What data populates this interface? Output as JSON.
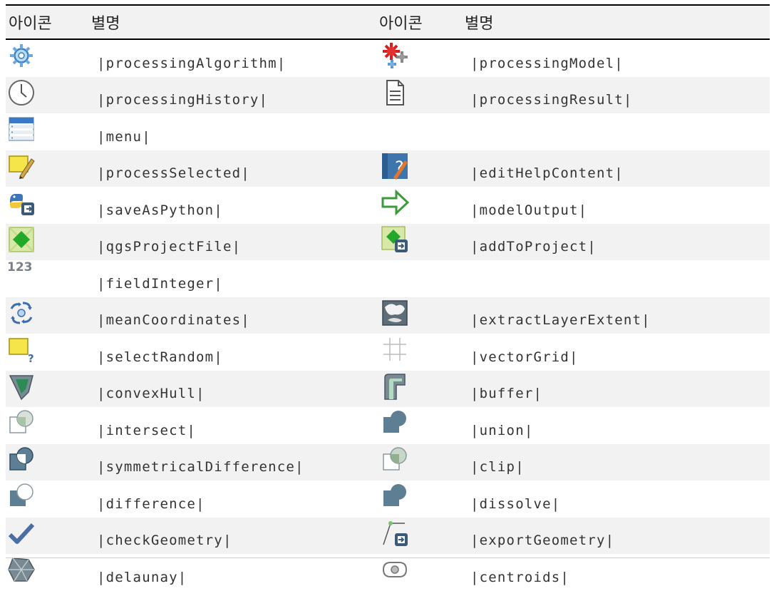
{
  "header": {
    "col1": "아이콘",
    "col2": "별명",
    "col3": "아이콘",
    "col4": "별명"
  },
  "rows": [
    {
      "icon1": "processing-algorithm-icon",
      "alias1": "|processingAlgorithm|",
      "icon2": "processing-model-icon",
      "alias2": "|processingModel|"
    },
    {
      "icon1": "processing-history-icon",
      "alias1": "|processingHistory|",
      "icon2": "processing-result-icon",
      "alias2": "|processingResult|"
    },
    {
      "icon1": "menu-icon",
      "alias1": "|menu|",
      "icon2": "",
      "alias2": ""
    },
    {
      "icon1": "process-selected-icon",
      "alias1": "|processSelected|",
      "icon2": "edit-help-content-icon",
      "alias2": "|editHelpContent|"
    },
    {
      "icon1": "save-as-python-icon",
      "alias1": "|saveAsPython|",
      "icon2": "model-output-icon",
      "alias2": "|modelOutput|"
    },
    {
      "icon1": "qgs-project-file-icon",
      "alias1": "|qgsProjectFile|",
      "icon2": "add-to-project-icon",
      "alias2": "|addToProject|"
    },
    {
      "icon1": "field-integer-icon",
      "icon1_text": "123",
      "alias1": "|fieldInteger|",
      "icon2": "",
      "alias2": ""
    },
    {
      "icon1": "mean-coordinates-icon",
      "alias1": "|meanCoordinates|",
      "icon2": "extract-layer-extent-icon",
      "alias2": "|extractLayerExtent|"
    },
    {
      "icon1": "select-random-icon",
      "alias1": "|selectRandom|",
      "icon2": "vector-grid-icon",
      "alias2": "|vectorGrid|"
    },
    {
      "icon1": "convex-hull-icon",
      "alias1": "|convexHull|",
      "icon2": "buffer-icon",
      "alias2": "|buffer|"
    },
    {
      "icon1": "intersect-icon",
      "alias1": "|intersect|",
      "icon2": "union-icon",
      "alias2": "|union|"
    },
    {
      "icon1": "symmetrical-difference-icon",
      "alias1": "|symmetricalDifference|",
      "icon2": "clip-icon",
      "alias2": "|clip|"
    },
    {
      "icon1": "difference-icon",
      "alias1": "|difference|",
      "icon2": "dissolve-icon",
      "alias2": "|dissolve|"
    },
    {
      "icon1": "check-geometry-icon",
      "alias1": "|checkGeometry|",
      "icon2": "export-geometry-icon",
      "alias2": "|exportGeometry|"
    },
    {
      "icon1": "delaunay-icon",
      "alias1": "|delaunay|",
      "icon2": "centroids-icon",
      "alias2": "|centroids|"
    }
  ]
}
